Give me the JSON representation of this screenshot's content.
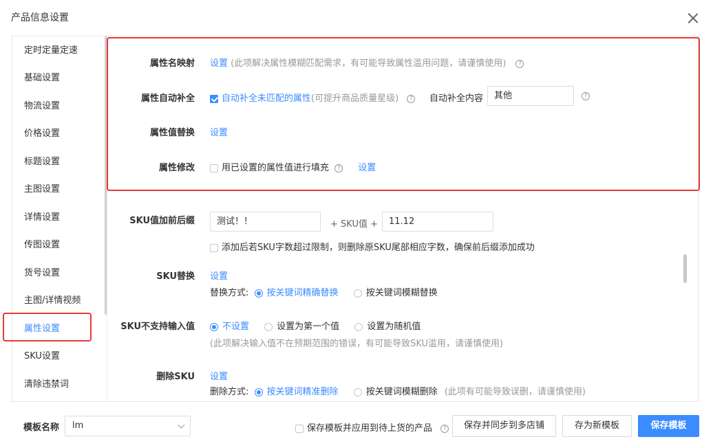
{
  "dialog": {
    "title": "产品信息设置"
  },
  "sidebar": {
    "items": [
      {
        "label": "定时定量定速"
      },
      {
        "label": "基础设置"
      },
      {
        "label": "物流设置"
      },
      {
        "label": "价格设置"
      },
      {
        "label": "标题设置"
      },
      {
        "label": "主图设置"
      },
      {
        "label": "详情设置"
      },
      {
        "label": "传图设置"
      },
      {
        "label": "货号设置"
      },
      {
        "label": "主图/详情视频"
      },
      {
        "label": "属性设置",
        "active": true
      },
      {
        "label": "SKU设置"
      },
      {
        "label": "清除违禁词"
      }
    ]
  },
  "attr_name_map": {
    "label": "属性名映射",
    "link": "设置",
    "hint": "(此项解决属性模糊匹配需求，有可能导致属性滥用问题，请谨慎使用)"
  },
  "attr_autofill": {
    "label": "属性自动补全",
    "checkbox_label": "自动补全未匹配的属性",
    "hint": "(可提升商品质量星级)",
    "content_label": "自动补全内容",
    "content_value": "其他"
  },
  "attr_value_replace": {
    "label": "属性值替换",
    "link": "设置"
  },
  "attr_modify": {
    "label": "属性修改",
    "checkbox_label": "用已设置的属性值进行填充",
    "link": "设置"
  },
  "sku_prefix_suffix": {
    "label": "SKU值加前后缀",
    "prefix_value": "测试！！",
    "middle_text": "+ SKU值 +",
    "suffix_value": "11.12",
    "checkbox_label": "添加后若SKU字数超过限制，则删除原SKU尾部相应字数，确保前后缀添加成功"
  },
  "sku_replace": {
    "label": "SKU替换",
    "link": "设置",
    "mode_label": "替换方式:",
    "options": [
      "按关键词精确替换",
      "按关键词模糊替换"
    ],
    "selected": 0
  },
  "sku_unsupported": {
    "label": "SKU不支持输入值",
    "options": [
      "不设置",
      "设置为第一个值",
      "设置为随机值"
    ],
    "selected": 0,
    "hint": "(此项解决输入值不在预期范围的错误，有可能导致SKU滥用，请谨慎使用)"
  },
  "sku_delete": {
    "label": "删除SKU",
    "link": "设置",
    "mode_label": "删除方式:",
    "options": [
      "按关键词精准删除",
      "按关键词模糊删除"
    ],
    "selected": 0,
    "hint": "(此项有可能导致误删，请谨慎使用)"
  },
  "footer": {
    "template_label": "模板名称",
    "template_value": "lm",
    "sync_checkbox_label": "保存模板并应用到待上货的产品",
    "btn_sync_shops": "保存并同步到多店铺",
    "btn_save_new": "存为新模板",
    "btn_save": "保存模板"
  },
  "colors": {
    "accent": "#3b8cff",
    "highlight": "#e53935"
  }
}
